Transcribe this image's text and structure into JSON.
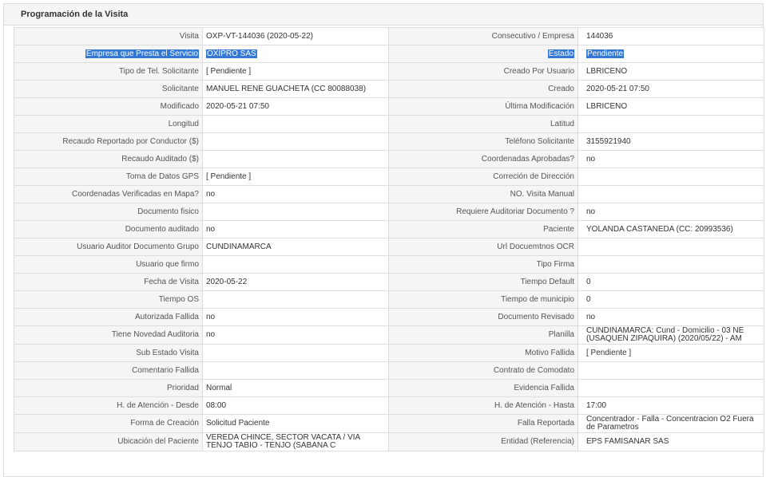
{
  "panel": {
    "title": "Programación de la Visita"
  },
  "rows": [
    {
      "l1": "Visita",
      "v1": "OXP-VT-144036 (2020-05-22)",
      "l2": "Consecutivo / Empresa",
      "v2": "144036"
    },
    {
      "l1": "Empresa que Presta el Servicio",
      "v1": "OXIPRO SAS",
      "l2": "Estado",
      "v2": "Pendiente"
    },
    {
      "l1": "Tipo de Tel. Solicitante",
      "v1": "[ Pendiente ]",
      "l2": "Creado Por Usuario",
      "v2": "LBRICENO"
    },
    {
      "l1": "Solicitante",
      "v1": "MANUEL RENE GUACHETA (CC 80088038)",
      "l2": "Creado",
      "v2": "2020-05-21 07:50"
    },
    {
      "l1": "Modificado",
      "v1": "2020-05-21 07:50",
      "l2": "Última Modificación",
      "v2": "LBRICENO"
    },
    {
      "l1": "Longitud",
      "v1": "",
      "l2": "Latitud",
      "v2": ""
    },
    {
      "l1": "Recaudo Reportado por Conductor ($)",
      "v1": "",
      "l2": "Teléfono Solicitante",
      "v2": "3155921940"
    },
    {
      "l1": "Recaudo Auditado ($)",
      "v1": "",
      "l2": "Coordenadas Aprobadas?",
      "v2": "no"
    },
    {
      "l1": "Toma de Datos GPS",
      "v1": "[ Pendiente ]",
      "l2": "Correción de Dirección",
      "v2": ""
    },
    {
      "l1": "Coordenadas Verificadas en Mapa?",
      "v1": "no",
      "l2": "NO. Visita Manual",
      "v2": ""
    },
    {
      "l1": "Documento fisico",
      "v1": "",
      "l2": "Requiere Auditoriar Documento ?",
      "v2": "no"
    },
    {
      "l1": "Documento auditado",
      "v1": "no",
      "l2": "Paciente",
      "v2": "YOLANDA CASTANEDA (CC: 20993536)"
    },
    {
      "l1": "Usuario Auditor Documento Grupo",
      "v1": "CUNDINAMARCA",
      "l2": "Url Docuemtnos OCR",
      "v2": ""
    },
    {
      "l1": "Usuario que firmo",
      "v1": "",
      "l2": "Tipo Firma",
      "v2": ""
    },
    {
      "l1": "Fecha de Visita",
      "v1": "2020-05-22",
      "l2": "Tiempo Default",
      "v2": "0"
    },
    {
      "l1": "Tiempo OS",
      "v1": "",
      "l2": "Tiempo de municipio",
      "v2": "0"
    },
    {
      "l1": "Autorizada Fallida",
      "v1": "no",
      "l2": "Documento Revisado",
      "v2": "no"
    },
    {
      "l1": "Tiene Novedad Auditoria",
      "v1": "no",
      "l2": "Planilla",
      "v2": "CUNDINAMARCA: Cund - Domicilio - 03 NE (USAQUEN ZIPAQUIRA) (2020/05/22) - AM"
    },
    {
      "l1": "Sub Estado Visita",
      "v1": "",
      "l2": "Motivo Fallida",
      "v2": "[ Pendiente ]"
    },
    {
      "l1": "Comentario Fallida",
      "v1": "",
      "l2": "Contrato de Comodato",
      "v2": ""
    },
    {
      "l1": "Prioridad",
      "v1": "Normal",
      "l2": "Evidencia Fallida",
      "v2": ""
    },
    {
      "l1": "H. de Atención - Desde",
      "v1": "08:00",
      "l2": "H. de Atención - Hasta",
      "v2": "17:00"
    },
    {
      "l1": "Forma de Creación",
      "v1": "Solicitud Paciente",
      "l2": "Falla Reportada",
      "v2": "Concentrador - Falla - Concentracion O2 Fuera de Parametros"
    },
    {
      "l1": "Ubicación del Paciente",
      "v1": "VEREDA CHINCE, SECTOR VACATA / VIA TENJO TABIO - TENJO (SABANA C",
      "l2": "Entidad (Referencia)",
      "v2": "EPS FAMISANAR SAS"
    }
  ]
}
